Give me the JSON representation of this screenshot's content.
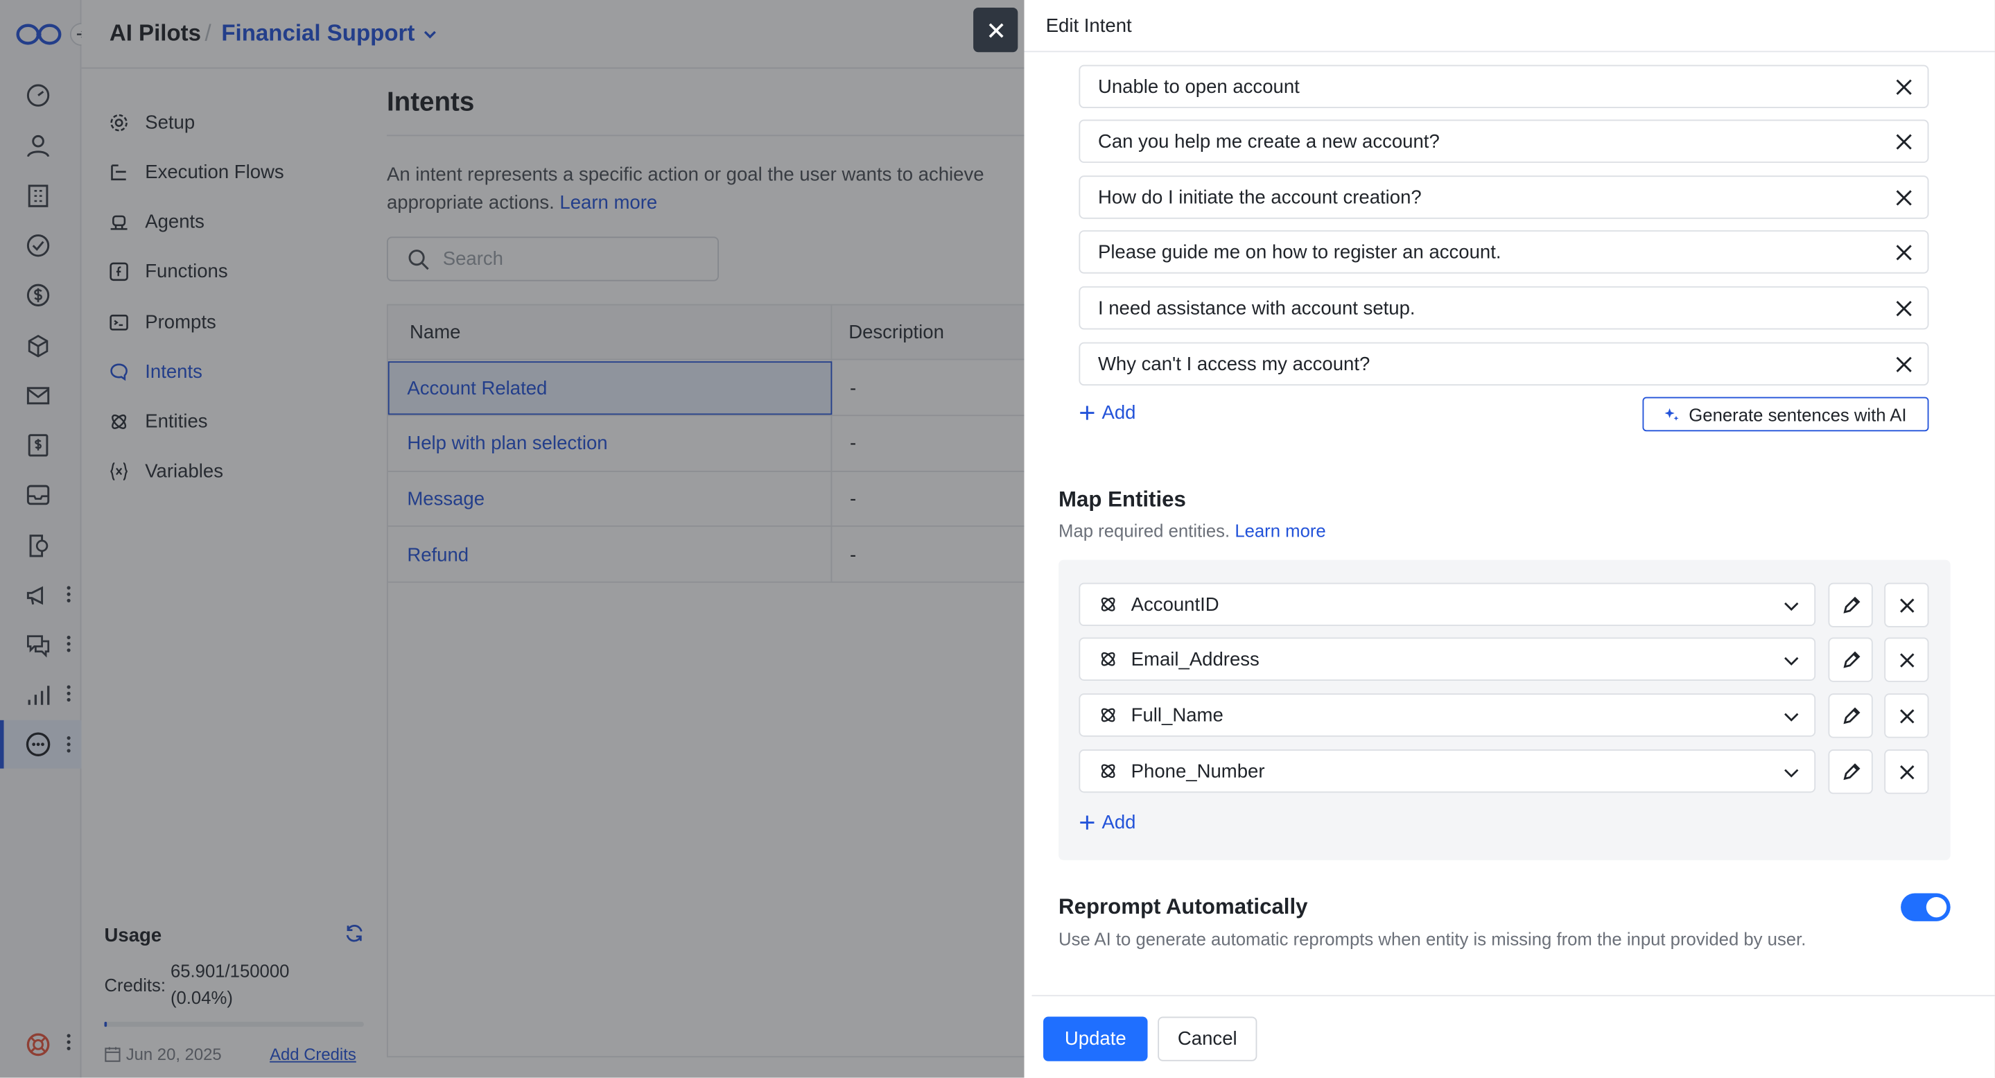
{
  "header": {
    "title": "AI Pilots",
    "separator": "/",
    "workspace": "Financial Support"
  },
  "sidebar": {
    "items": [
      {
        "label": "Setup",
        "icon": "gear-icon"
      },
      {
        "label": "Execution Flows",
        "icon": "flow-icon"
      },
      {
        "label": "Agents",
        "icon": "agent-icon"
      },
      {
        "label": "Functions",
        "icon": "function-icon"
      },
      {
        "label": "Prompts",
        "icon": "prompt-icon"
      },
      {
        "label": "Intents",
        "icon": "intent-icon",
        "active": true
      },
      {
        "label": "Entities",
        "icon": "entity-icon"
      },
      {
        "label": "Variables",
        "icon": "variable-icon"
      }
    ]
  },
  "usage": {
    "title": "Usage",
    "credits_label": "Credits:",
    "credits_value": "65.901/150000",
    "credits_pct": "(0.04%)",
    "progress_fraction": 0.0004,
    "date": "Jun 20, 2025",
    "add_credits": "Add Credits"
  },
  "main": {
    "title": "Intents",
    "description_line1": "An intent represents a specific action or goal the user wants to achieve",
    "description_line2": "appropriate actions.",
    "learn_more": "Learn more",
    "search_placeholder": "Search",
    "columns": [
      "Name",
      "Description"
    ],
    "rows": [
      {
        "name": "Account Related",
        "description": "-"
      },
      {
        "name": "Help with plan selection",
        "description": "-"
      },
      {
        "name": "Message",
        "description": "-"
      },
      {
        "name": "Refund",
        "description": "-"
      }
    ]
  },
  "panel": {
    "title": "Edit Intent",
    "utterances": [
      "Unable to open account",
      "Can you help me create a new account?",
      "How do I initiate the account creation?",
      "Please guide me on how to register an account.",
      "I need assistance with account setup.",
      "Why can't I access my account?"
    ],
    "add_label": "Add",
    "generate_label": "Generate sentences with AI",
    "map_entities": {
      "title": "Map Entities",
      "subtitle": "Map required entities.",
      "learn_more": "Learn more",
      "entities": [
        "AccountID",
        "Email_Address",
        "Full_Name",
        "Phone_Number"
      ],
      "add_label": "Add"
    },
    "reprompt": {
      "title": "Reprompt Automatically",
      "description": "Use AI to generate automatic reprompts when entity is missing from the input provided by user.",
      "enabled": true
    },
    "update_label": "Update",
    "cancel_label": "Cancel"
  },
  "colors": {
    "accent": "#2353d9",
    "button": "#1f6fff",
    "toggle": "#1f6fff",
    "dim_overlay": "rgba(35,37,42,0.45)",
    "close_button": "#2f3640"
  }
}
